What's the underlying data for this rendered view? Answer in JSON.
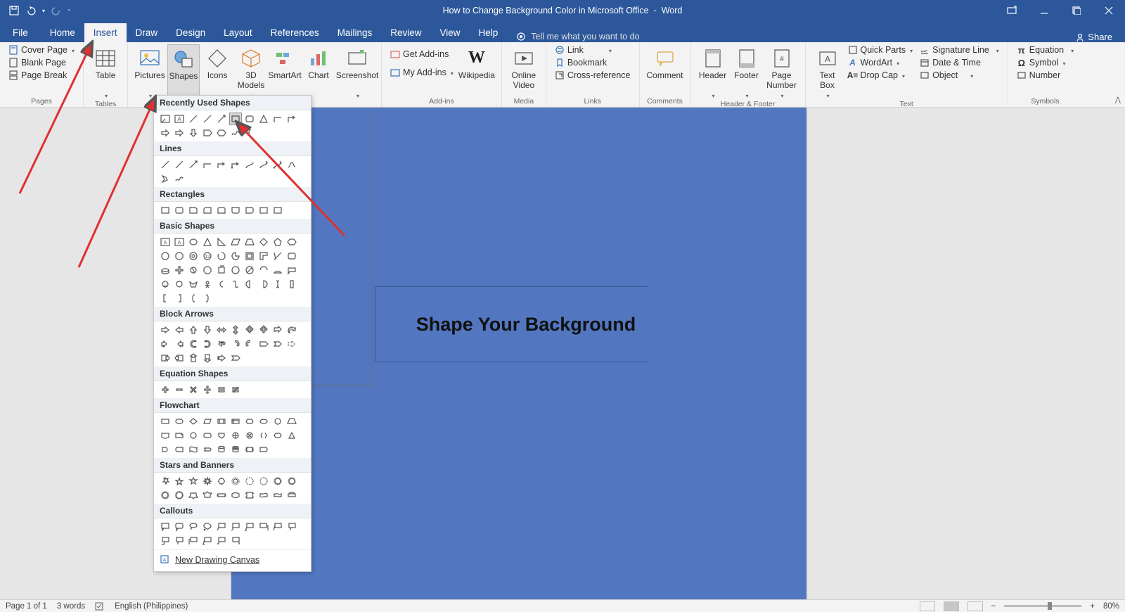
{
  "title": {
    "doc": "How to Change Background Color in Microsoft Office",
    "sep": "-",
    "app": "Word"
  },
  "menu": {
    "file": "File",
    "home": "Home",
    "insert": "Insert",
    "draw": "Draw",
    "design": "Design",
    "layout": "Layout",
    "references": "References",
    "mailings": "Mailings",
    "review": "Review",
    "view": "View",
    "help": "Help",
    "tellme": "Tell me what you want to do",
    "share": "Share"
  },
  "ribbon": {
    "pages": {
      "cover": "Cover Page",
      "blank": "Blank Page",
      "break": "Page Break",
      "label": "Pages"
    },
    "tables": {
      "table": "Table",
      "label": "Tables"
    },
    "illustrations": {
      "pictures": "Pictures",
      "shapes": "Shapes",
      "icons": "Icons",
      "models": "3D Models",
      "smartart": "SmartArt",
      "chart": "Chart",
      "screenshot": "Screenshot"
    },
    "addins": {
      "get": "Get Add-ins",
      "my": "My Add-ins",
      "wikipedia": "Wikipedia",
      "label": "Add-ins"
    },
    "media": {
      "video": "Online Video",
      "label": "Media"
    },
    "links": {
      "link": "Link",
      "bookmark": "Bookmark",
      "crossref": "Cross-reference",
      "label": "Links"
    },
    "comments": {
      "comment": "Comment",
      "label": "Comments"
    },
    "headerfooter": {
      "header": "Header",
      "footer": "Footer",
      "pageno": "Page Number",
      "label": "Header & Footer"
    },
    "text": {
      "textbox": "Text Box",
      "quickparts": "Quick Parts",
      "wordart": "WordArt",
      "dropcap": "Drop Cap",
      "sigline": "Signature Line",
      "datetime": "Date & Time",
      "object": "Object",
      "label": "Text"
    },
    "symbols": {
      "equation": "Equation",
      "symbol": "Symbol",
      "number": "Number",
      "label": "Symbols"
    }
  },
  "shapes_dd": {
    "recently": "Recently Used Shapes",
    "lines": "Lines",
    "rectangles": "Rectangles",
    "basic": "Basic Shapes",
    "arrows": "Block Arrows",
    "equation": "Equation Shapes",
    "flowchart": "Flowchart",
    "stars": "Stars and Banners",
    "callouts": "Callouts",
    "newcanvas": "New Drawing Canvas"
  },
  "document": {
    "shapetext": "Shape Your Background"
  },
  "status": {
    "page": "Page 1 of 1",
    "words": "3 words",
    "lang": "English (Philippines)",
    "zoom": "80%"
  }
}
